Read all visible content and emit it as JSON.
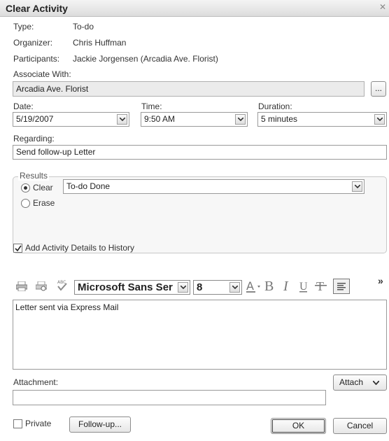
{
  "window": {
    "title": "Clear Activity"
  },
  "info": {
    "type_label": "Type:",
    "type_value": "To-do",
    "organizer_label": "Organizer:",
    "organizer_value": "Chris Huffman",
    "participants_label": "Participants:",
    "participants_value": "Jackie Jorgensen (Arcadia Ave. Florist)"
  },
  "associate": {
    "label": "Associate With:",
    "value": "Arcadia Ave. Florist",
    "browse_label": "..."
  },
  "schedule": {
    "date_label": "Date:",
    "date_value": "5/19/2007",
    "time_label": "Time:",
    "time_value": "9:50 AM",
    "duration_label": "Duration:",
    "duration_value": "5 minutes"
  },
  "regarding": {
    "label": "Regarding:",
    "value": "Send follow-up Letter"
  },
  "results": {
    "legend": "Results",
    "clear_label": "Clear",
    "erase_label": "Erase",
    "selected": "clear",
    "result_value": "To-do Done"
  },
  "history": {
    "label": "Add Activity Details to History",
    "checked": true
  },
  "toolbar": {
    "font_name": "Microsoft Sans Ser",
    "font_size": "8",
    "more": "»"
  },
  "details": {
    "text": "Letter sent via Express Mail"
  },
  "attachment": {
    "label": "Attachment:",
    "value": "",
    "attach_button": "Attach"
  },
  "footer": {
    "private_label": "Private",
    "private_checked": false,
    "followup_button": "Follow-up...",
    "ok_button": "OK",
    "cancel_button": "Cancel"
  }
}
